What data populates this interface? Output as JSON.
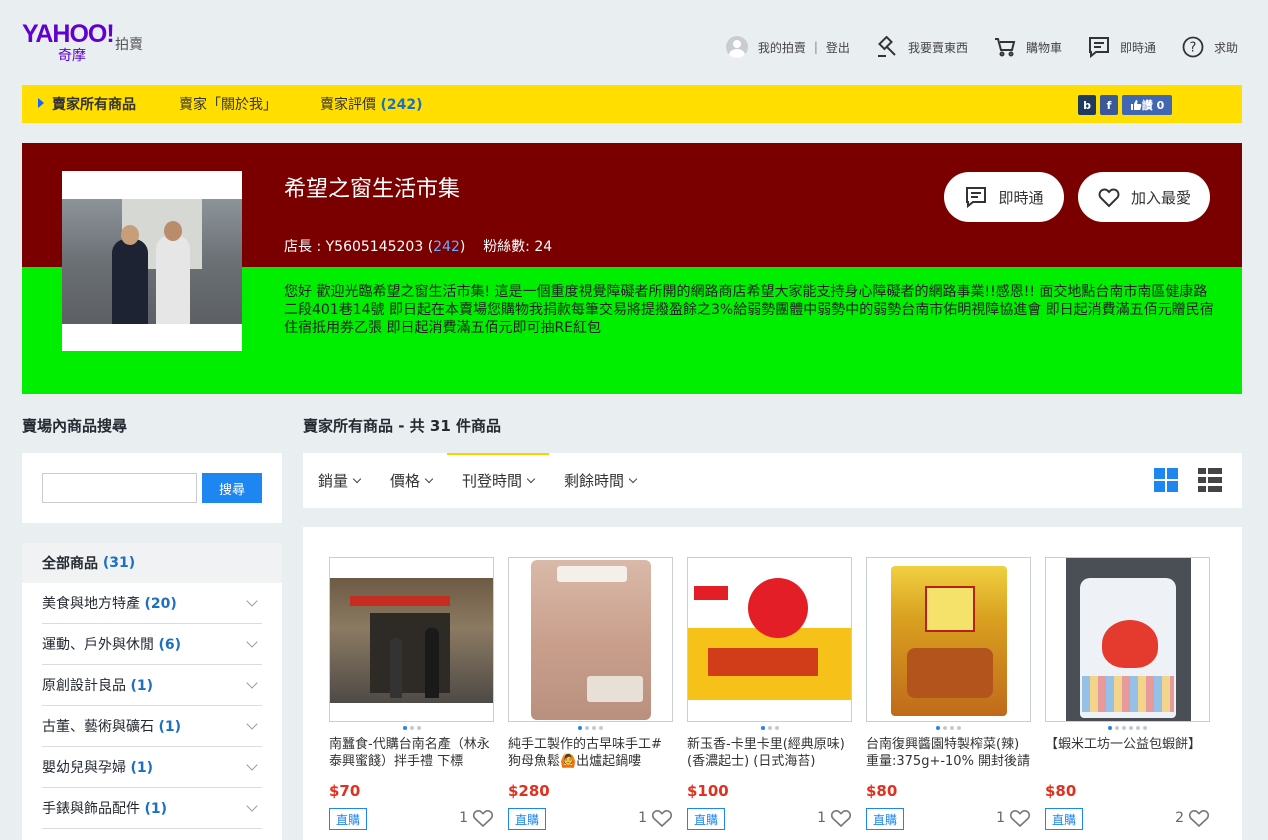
{
  "header": {
    "logo_main": "YAHOO!",
    "logo_sub": "奇摩",
    "logo_auction": "拍賣",
    "nav": {
      "my_auction": "我的拍賣",
      "divider": "|",
      "logout": "登出",
      "sell": "我要賣東西",
      "cart": "購物車",
      "messenger": "即時通",
      "help": "求助"
    }
  },
  "seller_bar": {
    "tabs": [
      {
        "label": "賣家所有商品"
      },
      {
        "label": "賣家「關於我」"
      },
      {
        "label": "賣家評價",
        "count": "(242)"
      }
    ],
    "social": {
      "b_icon": "b",
      "fb_icon": "f",
      "like_label": "讚 0"
    }
  },
  "store": {
    "name": "希望之窗生活市集",
    "owner_label": "店長 :",
    "owner_id": "Y5605145203",
    "rating_open": "(",
    "rating": "242",
    "rating_close": ")",
    "fans_label": "粉絲數:",
    "fans": "24",
    "chat_button": "即時通",
    "fav_button": "加入最愛",
    "description": "您好 歡迎光臨希望之窗生活市集! 這是一個重度視覺障礙者所開的網路商店希望大家能支持身心障礙者的網路事業!!感恩!! 面交地點台南市南區健康路二段401巷14號 即日起在本賣場您購物我捐款每筆交易將提撥盈餘之3%給弱勢團體中弱勢中的弱勢台南市佑明視障協進會 即日起消費滿五佰元贈民宿住宿抵用券乙張 即日起消費滿五佰元即可抽RE紅包",
    "colors": {
      "banner_top": "#7a0000",
      "banner_bottom": "#00ee00"
    }
  },
  "sidebar": {
    "title": "賣場內商品搜尋",
    "search": {
      "value": "",
      "placeholder": "",
      "button": "搜尋"
    },
    "all_label": "全部商品",
    "all_count": "(31)",
    "categories": [
      {
        "label": "美食與地方特產",
        "count": "(20)"
      },
      {
        "label": "運動、戶外與休閒",
        "count": "(6)"
      },
      {
        "label": "原創設計良品",
        "count": "(1)"
      },
      {
        "label": "古董、藝術與礦石",
        "count": "(1)"
      },
      {
        "label": "嬰幼兒與孕婦",
        "count": "(1)"
      },
      {
        "label": "手錶與飾品配件",
        "count": "(1)"
      }
    ]
  },
  "main": {
    "title_prefix": "賣家所有商品 - 共",
    "total": "31",
    "title_suffix": "件商品",
    "sort": [
      "銷量",
      "價格",
      "刊登時間",
      "剩餘時間"
    ],
    "active_sort": "刊登時間"
  },
  "products": [
    {
      "name": "南蠶食-代購台南名產（林永泰興蜜餞）拌手禮 下標",
      "price": "$70",
      "badge": "直購",
      "favs": "1",
      "img": "storefront-photo"
    },
    {
      "name": "純手工製作的古早味手工#狗母魚鬆🙆出爐起鍋嘍",
      "price": "$280",
      "badge": "直購",
      "favs": "1",
      "img": "fish-floss-bag"
    },
    {
      "name": "新玉香-卡里卡里(經典原味) (香濃起士) (日式海苔)",
      "price": "$100",
      "badge": "直購",
      "favs": "1",
      "img": "snack-package"
    },
    {
      "name": "台南復興醬園特製榨菜(辣) 重量:375g+-10% 開封後請",
      "price": "$80",
      "badge": "直購",
      "favs": "1",
      "img": "pickle-package"
    },
    {
      "name": "【蝦米工坊一公益包蝦餅】",
      "price": "$80",
      "badge": "直購",
      "favs": "2",
      "img": "cracker-bag"
    }
  ]
}
